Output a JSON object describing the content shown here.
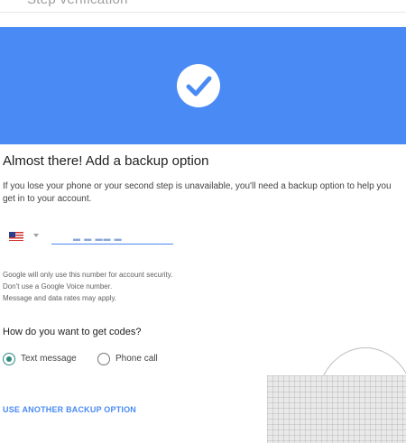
{
  "page": {
    "top_title_fragment": "Step verification"
  },
  "banner": {
    "color": "#4a8af4",
    "icon": "check-circle-icon"
  },
  "content": {
    "heading": "Almost there! Add a backup option",
    "description": "If you lose your phone or your second step is unavailable, you'll need a backup option to help you get in to your account."
  },
  "phone": {
    "country_flag": "us-flag-icon",
    "masked_value": "▬ ▬ ▬▬ ▬"
  },
  "notes": [
    "Google will only use this number for account security.",
    "Don't use a Google Voice number.",
    "Message and data rates may apply."
  ],
  "codes": {
    "question": "How do you want to get codes?",
    "options": [
      {
        "label": "Text message",
        "selected": true
      },
      {
        "label": "Phone call",
        "selected": false
      }
    ]
  },
  "actions": {
    "another_backup": "USE ANOTHER BACKUP OPTION"
  },
  "colors": {
    "accent": "#4a8af4",
    "radio_selected": "#2e8b82"
  }
}
